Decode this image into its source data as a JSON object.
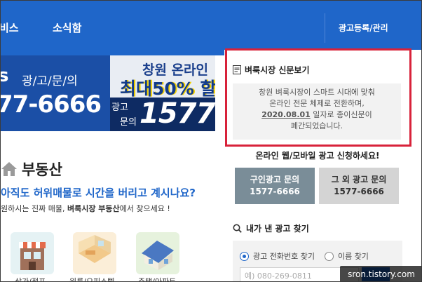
{
  "nav": {
    "items": [
      "비스",
      "소식함"
    ],
    "ad_register": "광고등록/관리"
  },
  "banner_left": {
    "letter": "s",
    "label": "광/고/문/의",
    "phone": "77-6666"
  },
  "banner_right": {
    "brand": "창원 온라인",
    "discount": "최대50% 할",
    "ad_label_1": "광고",
    "ad_label_2": "문의",
    "phone": "1577-"
  },
  "section": {
    "title": "부동산",
    "headline": "아직도 허위매물로 시간을 버리고 계시나요?",
    "sub_prefix": "원하시는 진짜 매물, ",
    "sub_bold": "벼룩시장 부동산",
    "sub_suffix": "에서 찾으세요 !"
  },
  "categories": [
    "상가/점포",
    "원룸/오피스텔",
    "주택/아파트"
  ],
  "notice": {
    "title": "벼룩시장 신문보기",
    "line1": "창원 벼룩시장이 스마트 시대에 맞춰",
    "line2": "온라인 전문 체제로 전환하며,",
    "date": "2020.08.01",
    "line3_suffix": " 일자로 종이신문이",
    "line4": "폐간되었습니다."
  },
  "apply": {
    "heading": "온라인 웹/모바일 광고 신청하세요!",
    "btn1_label": "구인광고 문의",
    "btn1_phone": "1577-6666",
    "btn2_label": "그 외 광고 문의",
    "btn2_phone": "1577-6666"
  },
  "find": {
    "heading": "내가 낸 광고 찾기",
    "radio1": "광고 전화번호 찾기",
    "radio2": "이름 찾기",
    "placeholder": "예) 080-269-0811"
  },
  "watermark": "sron.tistory.com",
  "colors": {
    "nav_blue": "#1f66c9",
    "highlight_red": "#d8223a",
    "button_slate": "#7a8d98"
  }
}
